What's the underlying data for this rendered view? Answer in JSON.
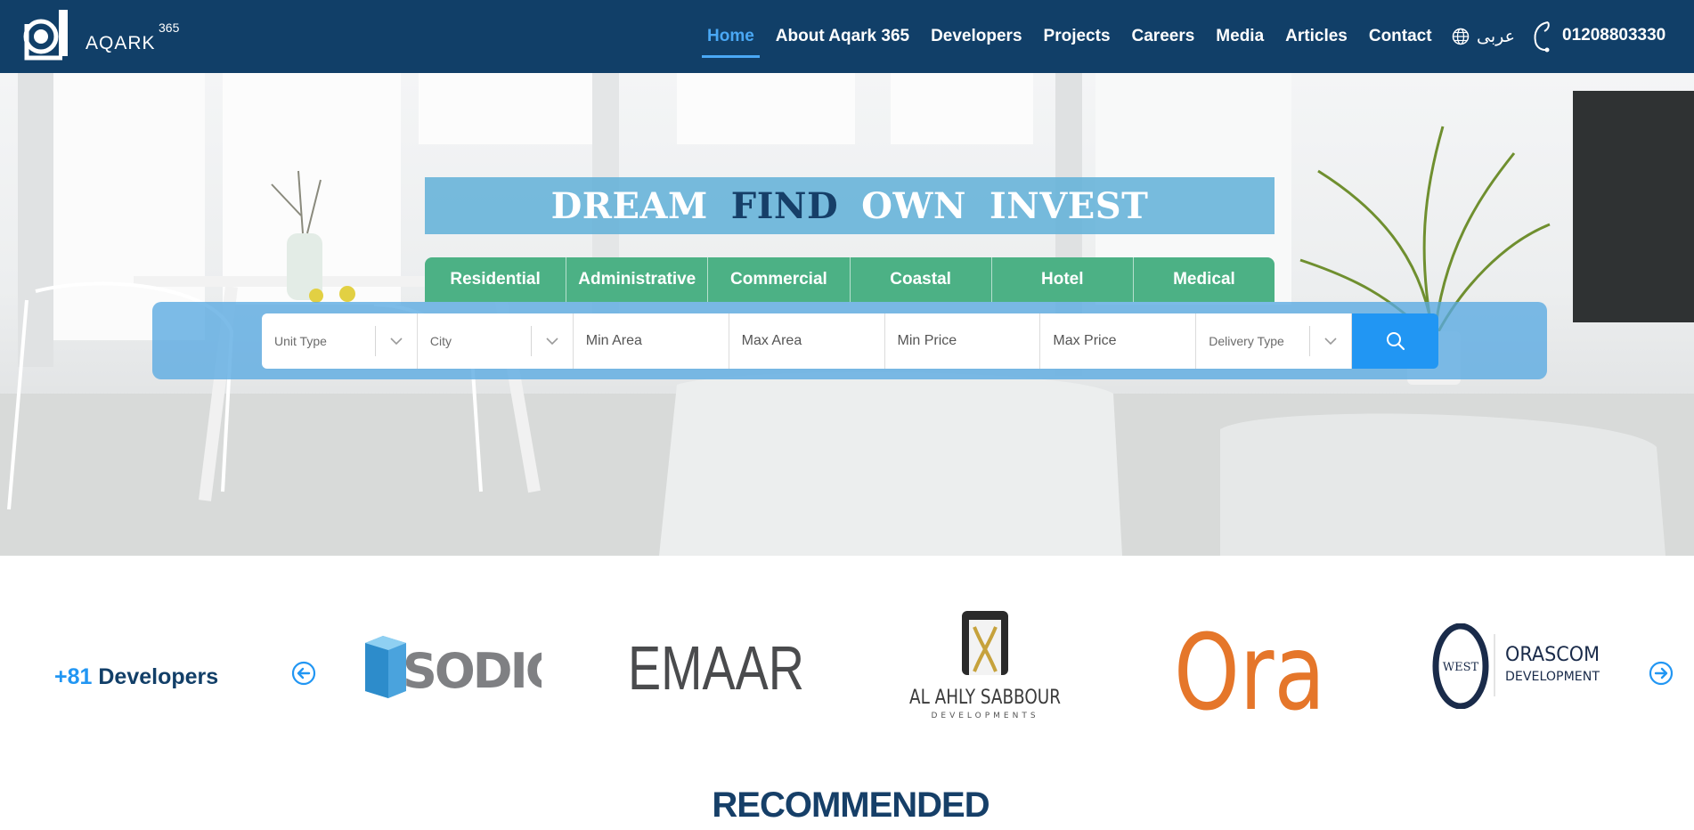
{
  "brand": {
    "name": "AQARK",
    "sup": "365"
  },
  "nav": {
    "links": [
      {
        "label": "Home",
        "active": true
      },
      {
        "label": "About Aqark 365",
        "active": false
      },
      {
        "label": "Developers",
        "active": false
      },
      {
        "label": "Projects",
        "active": false
      },
      {
        "label": "Careers",
        "active": false
      },
      {
        "label": "Media",
        "active": false
      },
      {
        "label": "Articles",
        "active": false
      },
      {
        "label": "Contact",
        "active": false
      }
    ],
    "language": "عربى",
    "phone": "01208803330"
  },
  "hero": {
    "banner_words": [
      "DREAM",
      "FIND",
      "OWN",
      "INVEST"
    ],
    "tabs": [
      "Residential",
      "Administrative",
      "Commercial",
      "Coastal",
      "Hotel",
      "Medical"
    ]
  },
  "search": {
    "unit_type": "Unit Type",
    "city": "City",
    "min_area": "Min Area",
    "max_area": "Max Area",
    "min_price": "Min Price",
    "max_price": "Max Price",
    "delivery_type": "Delivery Type"
  },
  "developers": {
    "count": "+81",
    "label": "Developers",
    "logos": {
      "sodic": "SODIC",
      "emaar": "EMAAR",
      "al_ahly_sabbour": "AL AHLY SABBOUR",
      "al_ahly_sabbour_sub": "DEVELOPMENTS",
      "ora": "Ora",
      "orascom_west": "WEST",
      "orascom_name": "ORASCOM",
      "orascom_sub": "DEVELOPMENT"
    }
  },
  "recommended": {
    "title": "RECOMMENDED"
  },
  "colors": {
    "navbar": "#113f68",
    "active_link": "#4aa8f5",
    "banner": "#64b2d8",
    "tabs": "#4cb185",
    "search_button": "#2196f3",
    "heading": "#163f68",
    "ora_orange": "#e5762a"
  }
}
